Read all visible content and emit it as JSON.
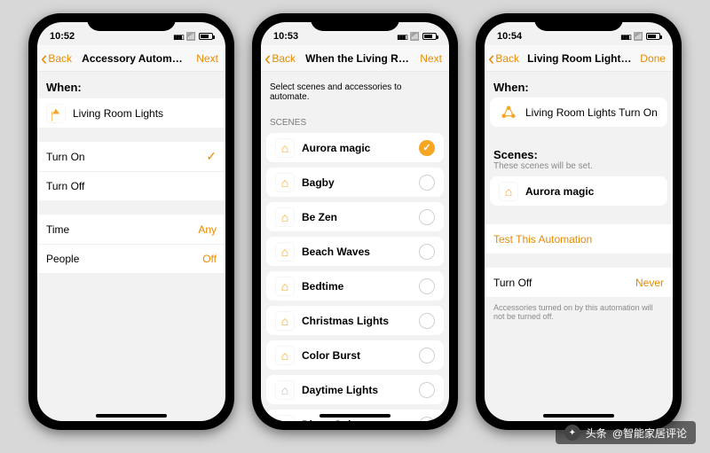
{
  "watermark": {
    "prefix": "头条",
    "name": "@智能家居评论"
  },
  "phones": [
    {
      "time": "10:52",
      "nav": {
        "back": "Back",
        "title": "Accessory Automation",
        "action": "Next"
      },
      "when_header": "When:",
      "accessory": {
        "name": "Living Room Lights"
      },
      "triggers": [
        {
          "label": "Turn On",
          "checked": true
        },
        {
          "label": "Turn Off",
          "checked": false
        }
      ],
      "conditions": [
        {
          "label": "Time",
          "value": "Any"
        },
        {
          "label": "People",
          "value": "Off"
        }
      ]
    },
    {
      "time": "10:53",
      "nav": {
        "back": "Back",
        "title": "When the Living Room Light…",
        "action": "Next"
      },
      "instruction": "Select scenes and accessories to automate.",
      "scenes_header": "SCENES",
      "scenes": [
        {
          "label": "Aurora magic",
          "selected": true
        },
        {
          "label": "Bagby",
          "selected": false
        },
        {
          "label": "Be Zen",
          "selected": false
        },
        {
          "label": "Beach Waves",
          "selected": false
        },
        {
          "label": "Bedtime",
          "selected": false
        },
        {
          "label": "Christmas Lights",
          "selected": false
        },
        {
          "label": "Color Burst",
          "selected": false
        },
        {
          "label": "Daytime Lights",
          "selected": false
        },
        {
          "label": "Disco Color",
          "selected": false
        }
      ]
    },
    {
      "time": "10:54",
      "nav": {
        "back": "Back",
        "title": "Living Room Lights Turn On",
        "action": "Done"
      },
      "when_header": "When:",
      "trigger_row": "Living Room Lights Turn On",
      "scenes_header": "Scenes:",
      "scenes_sub": "These scenes will be set.",
      "scene_selected": "Aurora magic",
      "test_label": "Test This Automation",
      "turn_off": {
        "label": "Turn Off",
        "value": "Never"
      },
      "footnote": "Accessories turned on by this automation will not be turned off."
    }
  ]
}
